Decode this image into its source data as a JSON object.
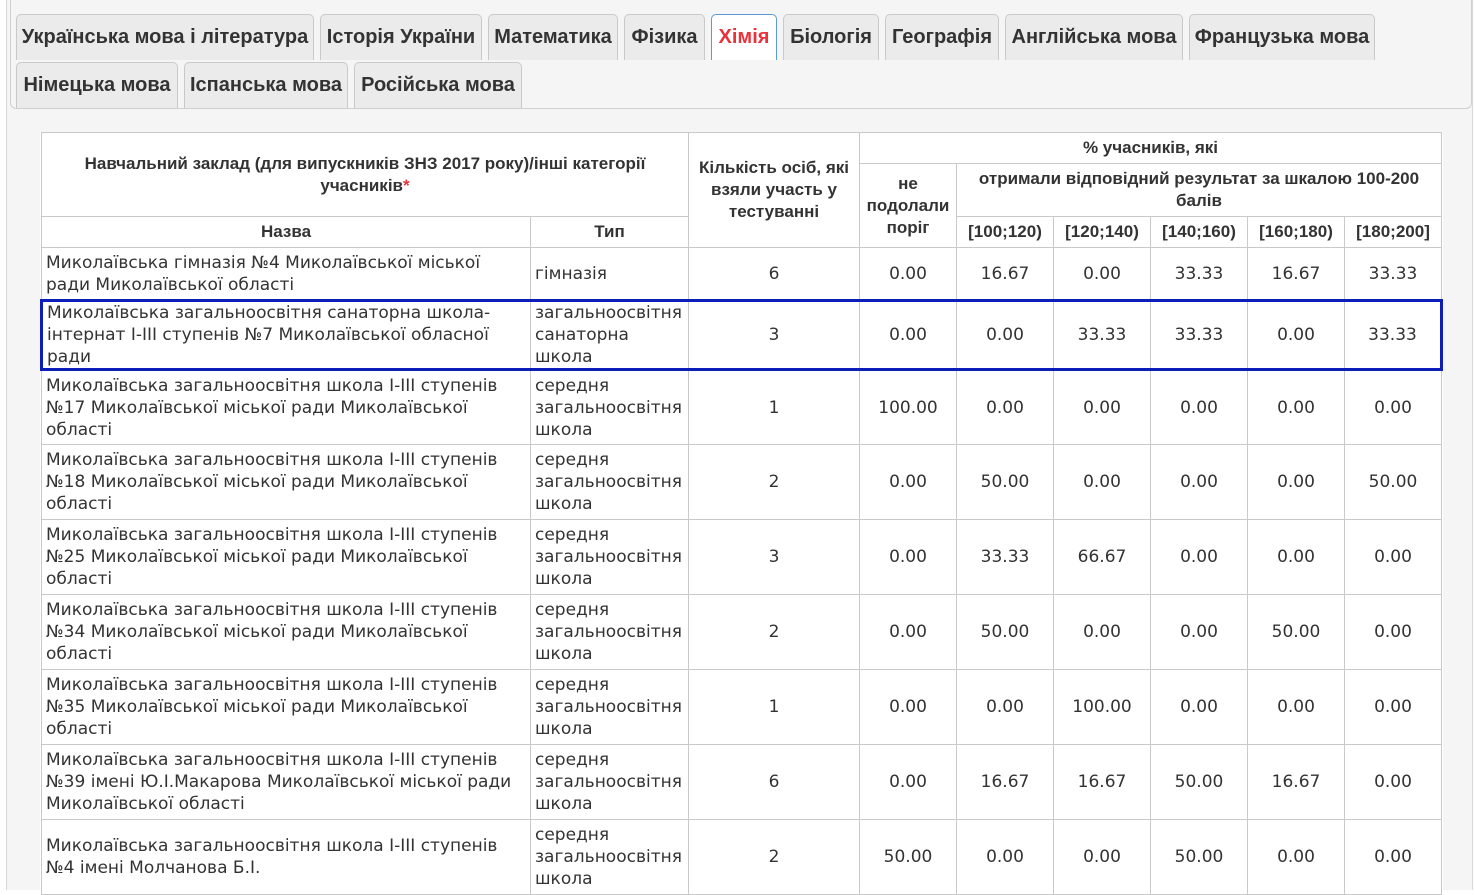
{
  "tabs": [
    {
      "label": "Українська мова і література",
      "active": false
    },
    {
      "label": "Історія України",
      "active": false
    },
    {
      "label": "Математика",
      "active": false
    },
    {
      "label": "Фізика",
      "active": false
    },
    {
      "label": "Хімія",
      "active": true
    },
    {
      "label": "Біологія",
      "active": false
    },
    {
      "label": "Географія",
      "active": false
    },
    {
      "label": "Англійська мова",
      "active": false
    },
    {
      "label": "Французька мова",
      "active": false
    },
    {
      "label": "Німецька мова",
      "active": false
    },
    {
      "label": "Іспанська мова",
      "active": false
    },
    {
      "label": "Російська мова",
      "active": false
    }
  ],
  "table": {
    "header": {
      "institution": "Навчальний заклад (для випускників ЗНЗ 2017 року)/інші категорії учасників",
      "required_mark": "*",
      "name": "Назва",
      "type": "Тип",
      "count": "Кількість осіб, які взяли участь у тестуванні",
      "percent": "% учасників, які",
      "failed": "не подолали поріг",
      "received": "отримали відповідний результат за шкалою 100-200 балів",
      "ranges": [
        "[100;120)",
        "[120;140)",
        "[140;160)",
        "[160;180)",
        "[180;200]"
      ]
    },
    "rows": [
      {
        "name": "Миколаївська гімназія №4 Миколаївської міської ради Миколаївської області",
        "type": "гімназія",
        "count": "6",
        "failed": "0.00",
        "r": [
          "16.67",
          "0.00",
          "33.33",
          "16.67",
          "33.33"
        ],
        "highlight": false
      },
      {
        "name": "Миколаївська загальноосвітня санаторна школа-інтернат І-ІІІ ступенів №7 Миколаївської обласної ради",
        "type": "загальноосвітня санаторна школа",
        "count": "3",
        "failed": "0.00",
        "r": [
          "0.00",
          "33.33",
          "33.33",
          "0.00",
          "33.33"
        ],
        "highlight": true
      },
      {
        "name": "Миколаївська загальноосвітня школа І-ІІІ ступенів №17 Миколаївської міської ради Миколаївської області",
        "type": "середня загальноосвітня школа",
        "count": "1",
        "failed": "100.00",
        "r": [
          "0.00",
          "0.00",
          "0.00",
          "0.00",
          "0.00"
        ],
        "highlight": false
      },
      {
        "name": "Миколаївська загальноосвітня школа І-ІІІ ступенів №18 Миколаївської міської ради Миколаївської області",
        "type": "середня загальноосвітня школа",
        "count": "2",
        "failed": "0.00",
        "r": [
          "50.00",
          "0.00",
          "0.00",
          "0.00",
          "50.00"
        ],
        "highlight": false
      },
      {
        "name": "Миколаївська загальноосвітня школа І-ІІІ ступенів №25 Миколаївської міської ради Миколаївської області",
        "type": "середня загальноосвітня школа",
        "count": "3",
        "failed": "0.00",
        "r": [
          "33.33",
          "66.67",
          "0.00",
          "0.00",
          "0.00"
        ],
        "highlight": false
      },
      {
        "name": "Миколаївська загальноосвітня школа І-ІІІ ступенів №34 Миколаївської міської ради Миколаївської області",
        "type": "середня загальноосвітня школа",
        "count": "2",
        "failed": "0.00",
        "r": [
          "50.00",
          "0.00",
          "0.00",
          "50.00",
          "0.00"
        ],
        "highlight": false
      },
      {
        "name": "Миколаївська загальноосвітня школа І-ІІІ ступенів №35 Миколаївської міської ради Миколаївської області",
        "type": "середня загальноосвітня школа",
        "count": "1",
        "failed": "0.00",
        "r": [
          "0.00",
          "100.00",
          "0.00",
          "0.00",
          "0.00"
        ],
        "highlight": false
      },
      {
        "name": "Миколаївська загальноосвітня школа І-ІІІ ступенів №39 імені Ю.І.Макарова Миколаївської міської ради Миколаївської області",
        "type": "середня загальноосвітня школа",
        "count": "6",
        "failed": "0.00",
        "r": [
          "16.67",
          "16.67",
          "50.00",
          "16.67",
          "0.00"
        ],
        "highlight": false
      },
      {
        "name": "Миколаївська загальноосвітня школа І-ІІІ ступенів №4 імені Молчанова Б.І.",
        "type": "середня загальноосвітня школа",
        "count": "2",
        "failed": "50.00",
        "r": [
          "0.00",
          "0.00",
          "50.00",
          "0.00",
          "0.00"
        ],
        "highlight": false
      }
    ]
  }
}
